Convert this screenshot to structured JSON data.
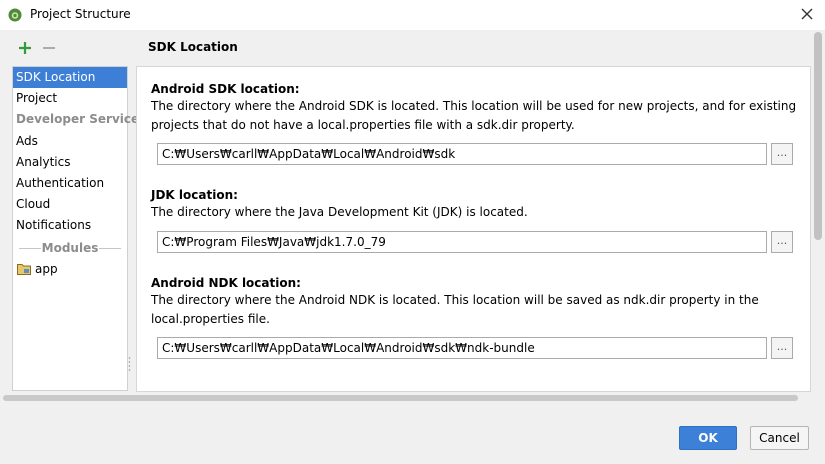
{
  "window": {
    "title": "Project Structure",
    "icon": "android-studio-icon"
  },
  "toolbar": {
    "add_icon": "plus-icon",
    "remove_icon": "minus-icon"
  },
  "sidebar": {
    "items": [
      {
        "label": "SDK Location"
      },
      {
        "label": "Project"
      },
      {
        "label": "Developer Services"
      },
      {
        "label": "Ads"
      },
      {
        "label": "Analytics"
      },
      {
        "label": "Authentication"
      },
      {
        "label": "Cloud"
      },
      {
        "label": "Notifications"
      }
    ],
    "modules_header": "Modules",
    "modules": [
      {
        "label": "app"
      }
    ]
  },
  "main": {
    "title": "SDK Location",
    "sections": [
      {
        "label": "Android SDK location:",
        "description": "The directory where the Android SDK is located. This location will be used for new projects, and for existing projects that do not have a local.properties file with a sdk.dir property.",
        "path": "C:₩Users₩carll₩AppData₩Local₩Android₩sdk",
        "browse": "..."
      },
      {
        "label": "JDK location:",
        "description": "The directory where the Java Development Kit (JDK) is located.",
        "path": "C:₩Program Files₩Java₩jdk1.7.0_79",
        "browse": "..."
      },
      {
        "label": "Android NDK location:",
        "description": "The directory where the Android NDK is located. This location will be saved as ndk.dir property in the local.properties file.",
        "path": "C:₩Users₩carll₩AppData₩Local₩Android₩sdk₩ndk-bundle",
        "browse": "..."
      }
    ]
  },
  "buttons": {
    "ok": "OK",
    "cancel": "Cancel"
  },
  "colors": {
    "selection": "#3d7fd6",
    "ok_button": "#3c80d8",
    "add_icon": "#2e9e3c"
  }
}
